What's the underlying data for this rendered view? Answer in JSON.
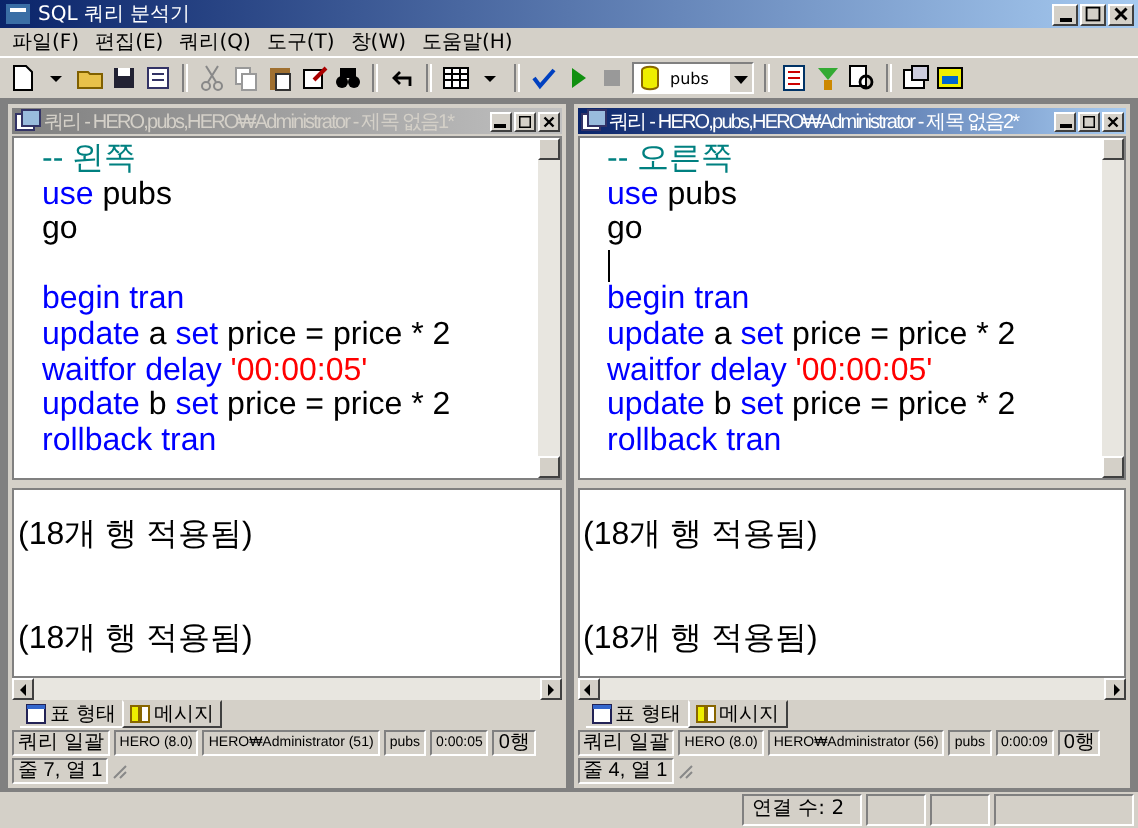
{
  "window": {
    "title": "SQL 쿼리 분석기"
  },
  "menu": [
    "파일(F)",
    "편집(E)",
    "쿼리(Q)",
    "도구(T)",
    "창(W)",
    "도움말(H)"
  ],
  "toolbar": {
    "database": "pubs"
  },
  "panes": [
    {
      "title": "쿼리 - HERO,pubs,HERO₩Administrator - 제목 없음1*",
      "active": false,
      "lines": [
        {
          "caret": false,
          "tokens": [
            {
              "kind": "comment",
              "text": "-- 왼쪽"
            }
          ]
        },
        {
          "caret": false,
          "tokens": [
            {
              "kind": "keyword",
              "text": "use"
            },
            {
              "kind": "plain",
              "text": "pubs"
            }
          ]
        },
        {
          "caret": false,
          "tokens": [
            {
              "kind": "plain",
              "text": "go"
            }
          ]
        },
        {
          "caret": false
        },
        {
          "caret": false,
          "tokens": [
            {
              "kind": "keyword",
              "text": "begin tran"
            }
          ]
        },
        {
          "caret": false,
          "tokens": [
            {
              "kind": "keyword",
              "text": "update"
            },
            {
              "kind": "plain",
              "text": "a"
            },
            {
              "kind": "keyword",
              "text": "set"
            },
            {
              "kind": "plain",
              "text": "price = price * 2"
            }
          ]
        },
        {
          "caret": false,
          "tokens": [
            {
              "kind": "keyword",
              "text": "waitfor delay"
            },
            {
              "kind": "string",
              "text": "'00:00:05'"
            }
          ]
        },
        {
          "caret": false,
          "tokens": [
            {
              "kind": "keyword",
              "text": "update"
            },
            {
              "kind": "plain",
              "text": "b"
            },
            {
              "kind": "keyword",
              "text": "set"
            },
            {
              "kind": "plain",
              "text": "price = price * 2"
            }
          ]
        },
        {
          "caret": false,
          "tokens": [
            {
              "kind": "keyword",
              "text": "rollback tran"
            }
          ]
        }
      ],
      "messages": [
        "(18개 행 적용됨)",
        "(18개 행 적용됨)"
      ],
      "tabs": [
        {
          "label": "표 형태",
          "selected": false
        },
        {
          "label": "메시지",
          "selected": true
        }
      ],
      "status": [
        "쿼리 일괄",
        "HERO (8.0)",
        "HERO₩Administrator (51)",
        "pubs",
        "0:00:05",
        "0행",
        "줄 7, 열 1"
      ]
    },
    {
      "title": "쿼리 - HERO,pubs,HERO₩Administrator - 제목 없음2*",
      "active": true,
      "lines": [
        {
          "caret": false,
          "tokens": [
            {
              "kind": "comment",
              "text": "-- 오른쪽"
            }
          ]
        },
        {
          "caret": false,
          "tokens": [
            {
              "kind": "keyword",
              "text": "use"
            },
            {
              "kind": "plain",
              "text": "pubs"
            }
          ]
        },
        {
          "caret": false,
          "tokens": [
            {
              "kind": "plain",
              "text": "go"
            }
          ]
        },
        {
          "caret": true
        },
        {
          "caret": false,
          "tokens": [
            {
              "kind": "keyword",
              "text": "begin tran"
            }
          ]
        },
        {
          "caret": false,
          "tokens": [
            {
              "kind": "keyword",
              "text": "update"
            },
            {
              "kind": "plain",
              "text": "a"
            },
            {
              "kind": "keyword",
              "text": "set"
            },
            {
              "kind": "plain",
              "text": "price = price * 2"
            }
          ]
        },
        {
          "caret": false,
          "tokens": [
            {
              "kind": "keyword",
              "text": "waitfor delay"
            },
            {
              "kind": "string",
              "text": "'00:00:05'"
            }
          ]
        },
        {
          "caret": false,
          "tokens": [
            {
              "kind": "keyword",
              "text": "update"
            },
            {
              "kind": "plain",
              "text": "b"
            },
            {
              "kind": "keyword",
              "text": "set"
            },
            {
              "kind": "plain",
              "text": "price = price * 2"
            }
          ]
        },
        {
          "caret": false,
          "tokens": [
            {
              "kind": "keyword",
              "text": "rollback tran"
            }
          ]
        }
      ],
      "messages": [
        "(18개 행 적용됨)",
        "(18개 행 적용됨)"
      ],
      "tabs": [
        {
          "label": "표 형태",
          "selected": false
        },
        {
          "label": "메시지",
          "selected": true
        }
      ],
      "status": [
        "쿼리 일괄",
        "HERO (8.0)",
        "HERO₩Administrator (56)",
        "pubs",
        "0:00:09",
        "0행",
        "줄 4, 열 1"
      ]
    }
  ],
  "status_bar": {
    "connections": "연결 수: 2"
  }
}
